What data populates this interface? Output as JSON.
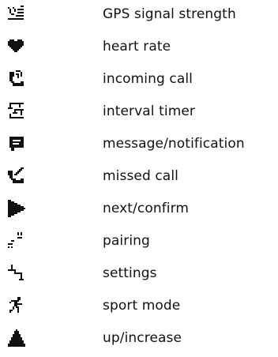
{
  "legend": {
    "items": [
      {
        "icon": "gps-signal-icon",
        "label": "GPS signal strength"
      },
      {
        "icon": "heart-icon",
        "label": "heart rate"
      },
      {
        "icon": "incoming-call-icon",
        "label": "incoming call"
      },
      {
        "icon": "interval-timer-icon",
        "label": "interval timer"
      },
      {
        "icon": "message-icon",
        "label": "message/notification"
      },
      {
        "icon": "missed-call-icon",
        "label": "missed call"
      },
      {
        "icon": "next-arrow-icon",
        "label": "next/confirm"
      },
      {
        "icon": "pairing-icon",
        "label": "pairing"
      },
      {
        "icon": "settings-icon",
        "label": "settings"
      },
      {
        "icon": "sport-mode-icon",
        "label": "sport mode"
      },
      {
        "icon": "up-arrow-icon",
        "label": "up/increase"
      }
    ]
  }
}
